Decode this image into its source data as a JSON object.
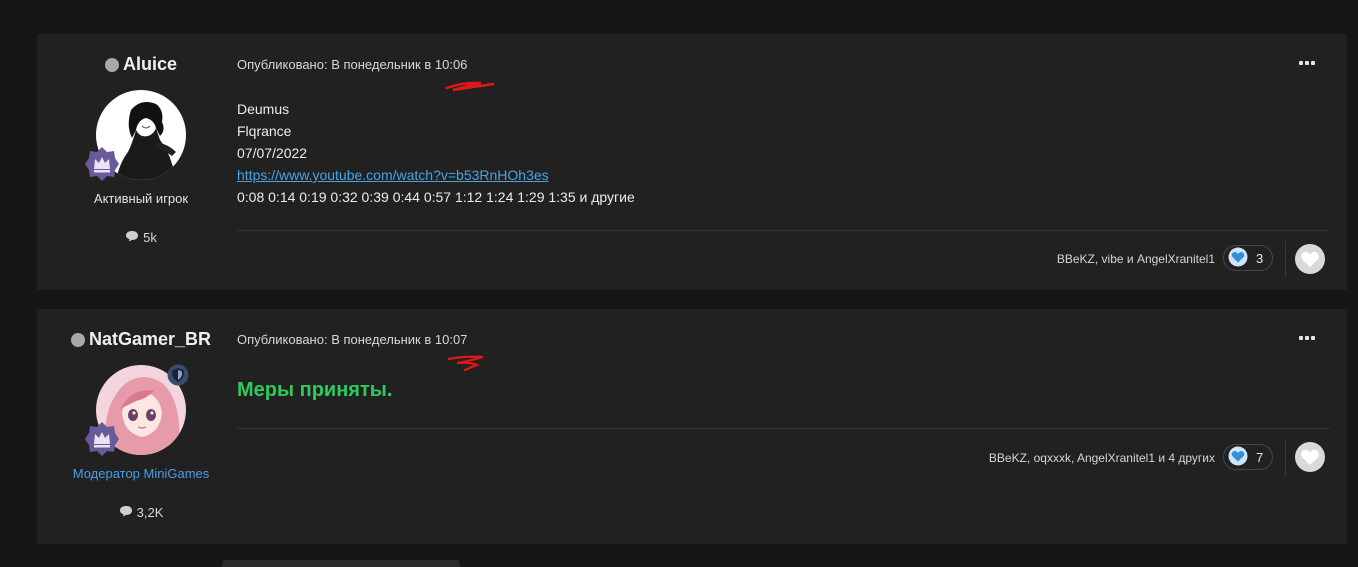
{
  "posts": [
    {
      "author": {
        "name": "Aluice",
        "role": "Активный игрок",
        "role_color": "#d8d8d8",
        "posts_count": "5k",
        "status_icon": "offline-dot-icon",
        "badge": "crown-icon"
      },
      "published": "Опубликовано: В понедельник в 10:06",
      "lines": [
        "Deumus",
        "Flqrance",
        "07/07/2022"
      ],
      "link": "https://www.youtube.com/watch?v=b53RnHOh3es",
      "timestamps_line": "0:08 0:14 0:19 0:32 0:39 0:44 0:57 1:12 1:24 1:29 1:35 и другие",
      "reactions": {
        "names": "BBeKZ, vibe и AngelXranitel1",
        "count": "3"
      }
    },
    {
      "author": {
        "name": "NatGamer_BR",
        "role": "Модератор MiniGames",
        "role_color": "#4a9ee8",
        "posts_count": "3,2K",
        "status_icon": "offline-dot-icon",
        "badge": "crown-icon",
        "mod_badge": "shield-icon"
      },
      "published": "Опубликовано: В понедельник в 10:07",
      "message": "Меры приняты.",
      "message_color": "#2ec95f",
      "reactions": {
        "names": "BBeKZ, oqxxxk, AngelXranitel1 и 4 других",
        "count": "7"
      }
    }
  ],
  "colors": {
    "background": "#161617",
    "card": "#212122",
    "link": "#4aa3df",
    "scribble": "#e01818",
    "reaction_heart": "#2f8fd8"
  }
}
